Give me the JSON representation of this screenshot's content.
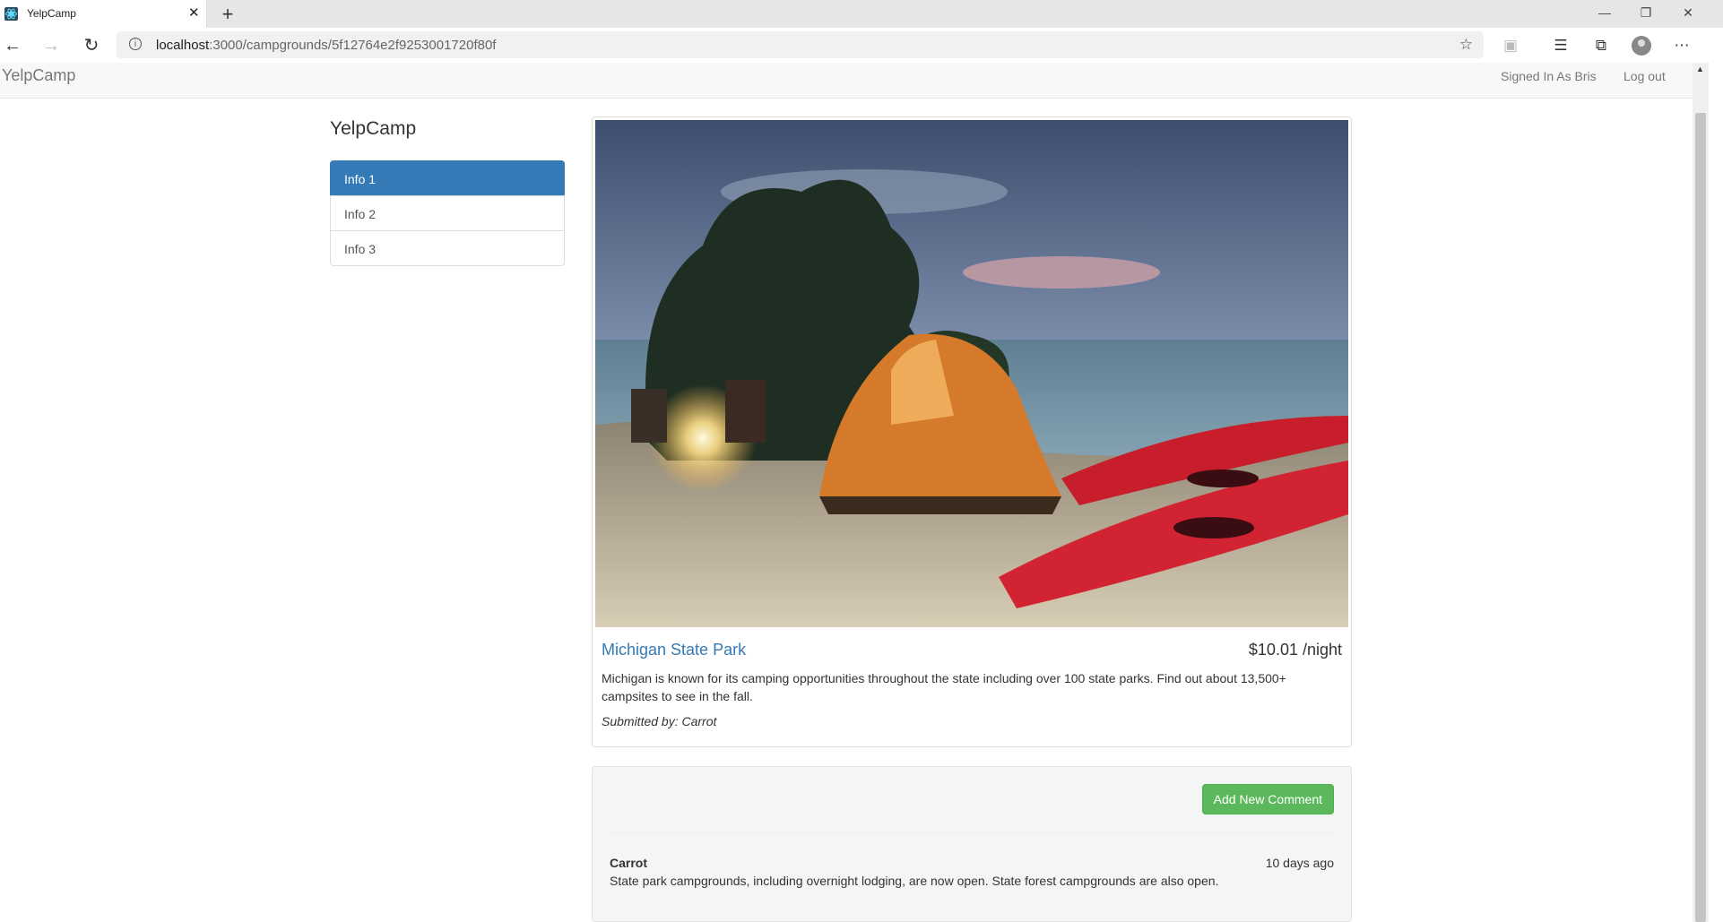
{
  "browser": {
    "tab_title": "YelpCamp",
    "url_host": "localhost",
    "url_rest": ":3000/campgrounds/5f12764e2f9253001720f80f"
  },
  "navbar": {
    "brand": "YelpCamp",
    "signed_in": "Signed In As Bris",
    "logout": "Log out"
  },
  "sidebar": {
    "lead": "YelpCamp",
    "items": [
      {
        "label": "Info 1",
        "active": true
      },
      {
        "label": "Info 2",
        "active": false
      },
      {
        "label": "Info 3",
        "active": false
      }
    ]
  },
  "campground": {
    "name": "Michigan State Park",
    "price": "$10.01 /night",
    "description": "Michigan is known for its camping opportunities throughout the state including over 100 state parks. Find out about 13,500+ campsites to see in the fall.",
    "submitted_by": "Submitted by: Carrot"
  },
  "comments": {
    "add_button": "Add New Comment",
    "items": [
      {
        "author": "Carrot",
        "time": "10 days ago",
        "text": "State park campgrounds, including overnight lodging, are now open. State forest campgrounds are also open."
      }
    ]
  },
  "colors": {
    "primary": "#337ab7",
    "success": "#5cb85c",
    "navbar_bg": "#f8f8f8"
  }
}
